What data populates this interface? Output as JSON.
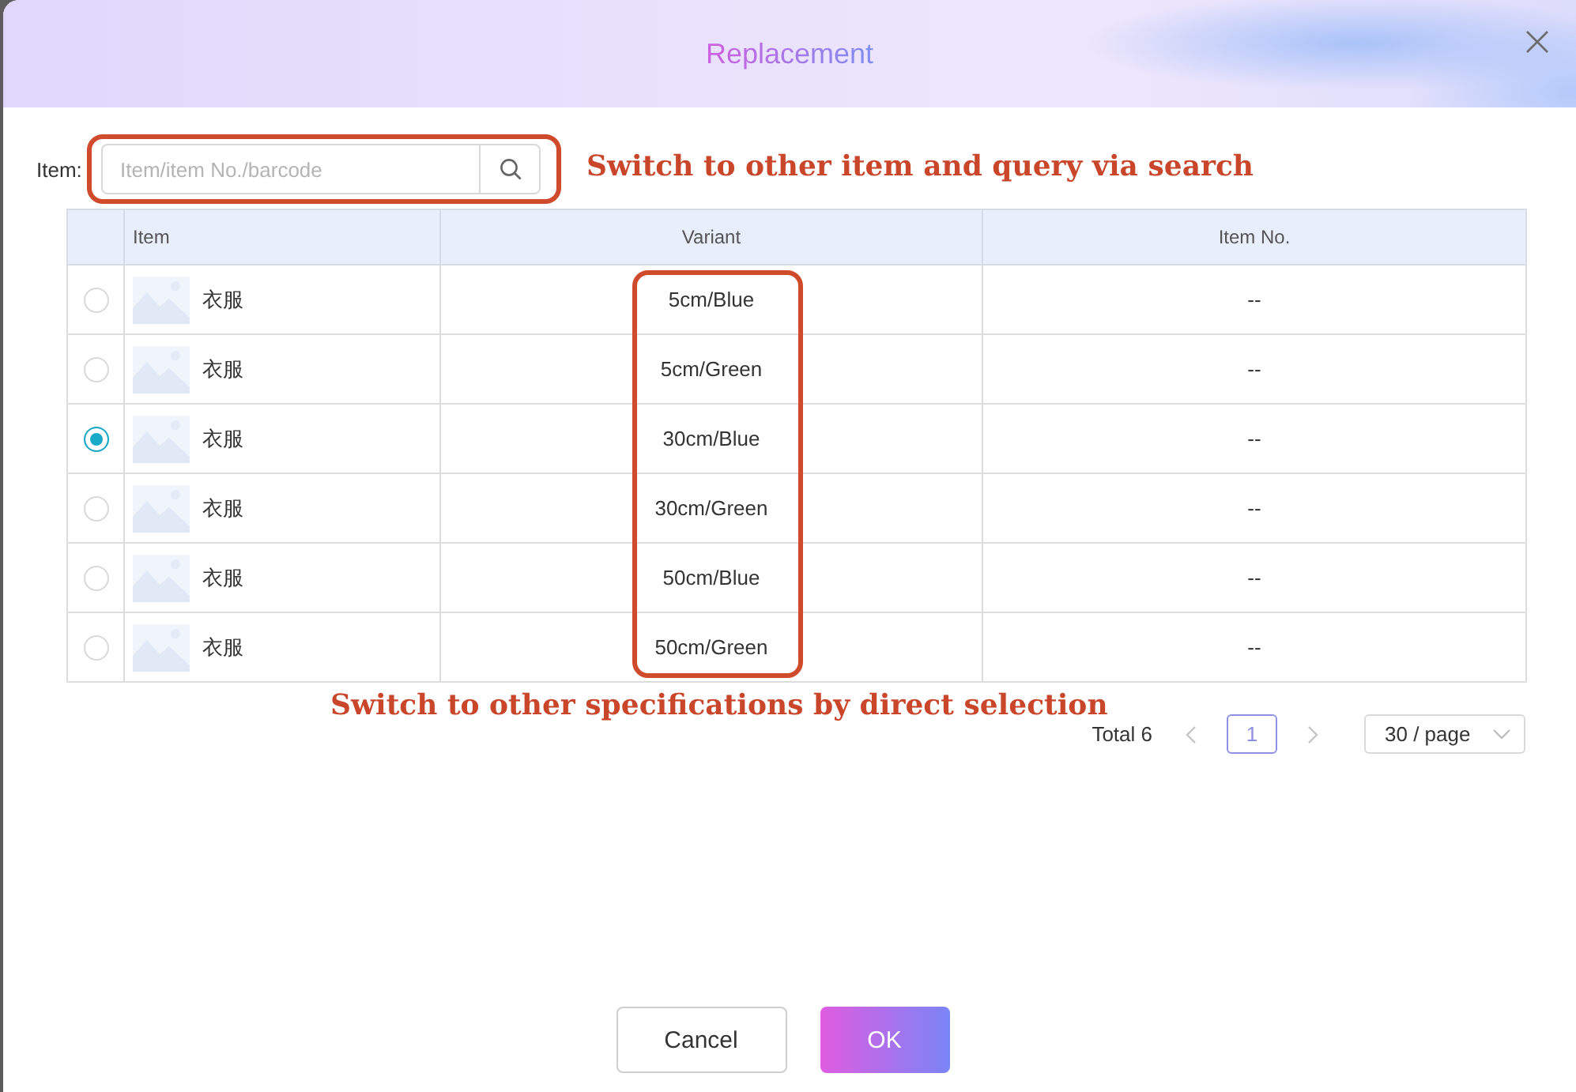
{
  "dialog": {
    "title": "Replacement"
  },
  "search": {
    "label": "Item:",
    "placeholder": "Item/item No./barcode"
  },
  "annotations": {
    "search": "Switch to other item and query via search",
    "variants": "Switch to other specifications by direct selection"
  },
  "table": {
    "columns": [
      "Item",
      "Variant",
      "Item No."
    ],
    "rows": [
      {
        "selected": false,
        "item": "衣服",
        "variant": "5cm/Blue",
        "item_no": "--"
      },
      {
        "selected": false,
        "item": "衣服",
        "variant": "5cm/Green",
        "item_no": "--"
      },
      {
        "selected": true,
        "item": "衣服",
        "variant": "30cm/Blue",
        "item_no": "--"
      },
      {
        "selected": false,
        "item": "衣服",
        "variant": "30cm/Green",
        "item_no": "--"
      },
      {
        "selected": false,
        "item": "衣服",
        "variant": "50cm/Blue",
        "item_no": "--"
      },
      {
        "selected": false,
        "item": "衣服",
        "variant": "50cm/Green",
        "item_no": "--"
      }
    ]
  },
  "pagination": {
    "total": "Total 6",
    "prev": {
      "disabled": true
    },
    "pages": [
      {
        "label": "1",
        "selected": true
      }
    ],
    "next": {
      "disabled": true
    },
    "page_size": "30 / page"
  },
  "buttons": [
    {
      "label": "Cancel",
      "kind": "secondary"
    },
    {
      "label": "OK",
      "kind": "primary"
    }
  ]
}
